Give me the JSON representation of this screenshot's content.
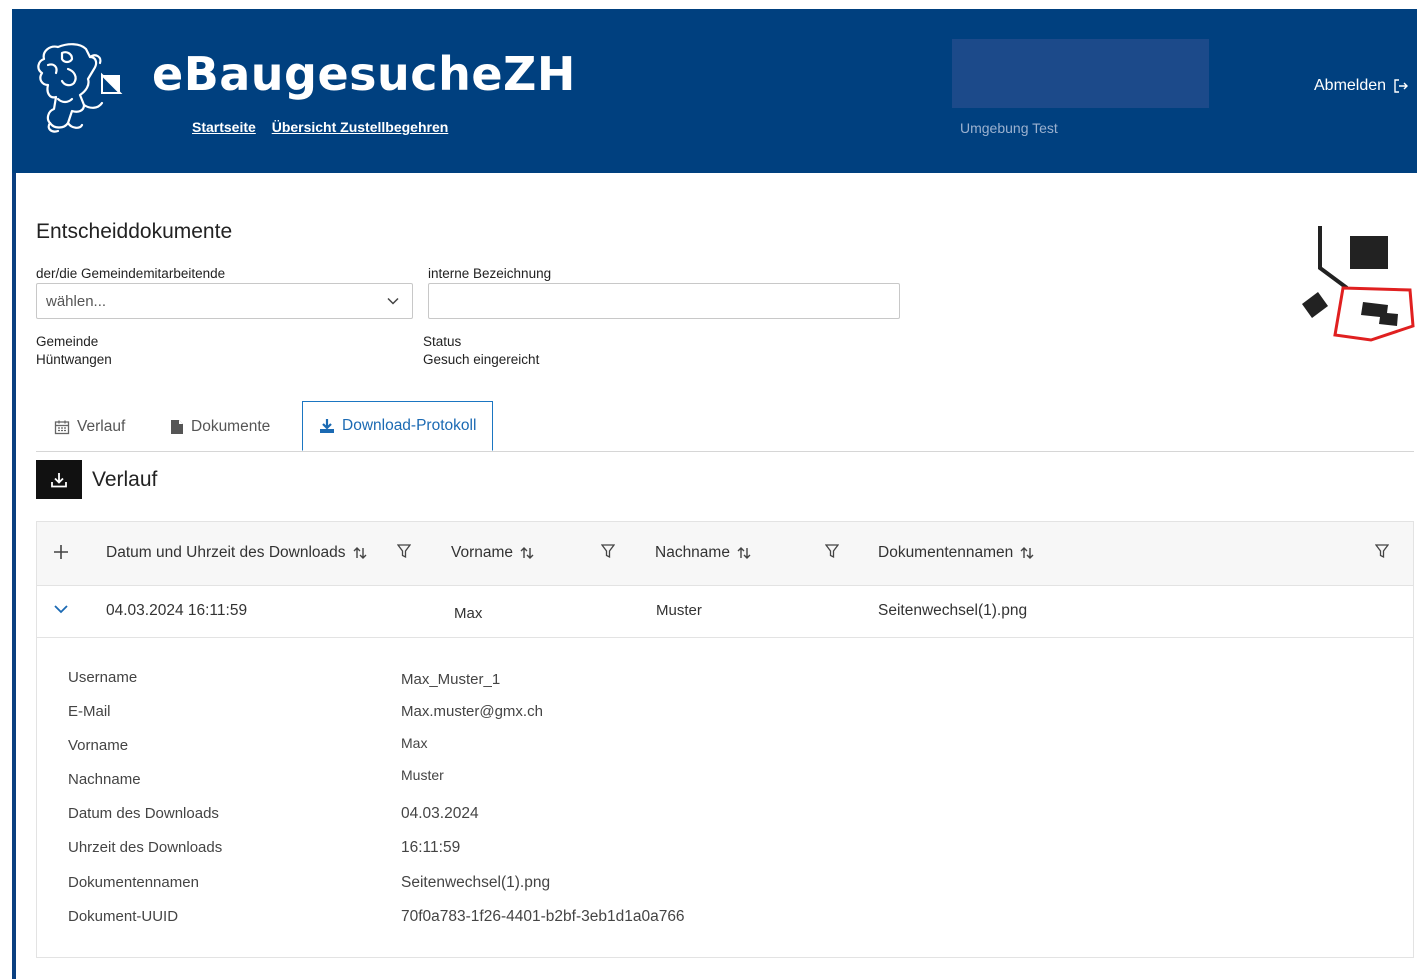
{
  "header": {
    "app_title": "eBaugesucheZH",
    "nav": [
      {
        "label": "Startseite"
      },
      {
        "label": "Übersicht Zustellbegehren"
      }
    ],
    "environment_label": "Umgebung Test",
    "logout_label": "Abmelden"
  },
  "form": {
    "page_title": "Entscheiddokumente",
    "employee_label": "der/die Gemeindemitarbeitende",
    "employee_value": "wählen...",
    "internal_label": "interne Bezeichnung",
    "internal_value": "",
    "municipality_label": "Gemeinde",
    "municipality_value": "Hüntwangen",
    "status_label": "Status",
    "status_value": "Gesuch eingereicht"
  },
  "tabs": [
    {
      "label": "Verlauf",
      "icon": "calendar-icon"
    },
    {
      "label": "Dokumente",
      "icon": "document-icon"
    },
    {
      "label": "Download-Protokoll",
      "icon": "download-icon",
      "active": true
    }
  ],
  "section": {
    "title": "Verlauf"
  },
  "table": {
    "columns": [
      "Datum und Uhrzeit des Downloads",
      "Vorname",
      "Nachname",
      "Dokumentennamen"
    ],
    "rows": [
      {
        "datetime": "04.03.2024 16:11:59",
        "first_name": "Max",
        "last_name": "Muster",
        "document": "Seitenwechsel(1).png"
      }
    ],
    "details": [
      {
        "label": "Username",
        "value": "Max_Muster_1"
      },
      {
        "label": "E-Mail",
        "value": "Max.muster@gmx.ch"
      },
      {
        "label": "Vorname",
        "value": "Max"
      },
      {
        "label": "Nachname",
        "value": "Muster"
      },
      {
        "label": "Datum des Downloads",
        "value": "04.03.2024"
      },
      {
        "label": "Uhrzeit des Downloads",
        "value": "16:11:59"
      },
      {
        "label": "Dokumentennamen",
        "value": "Seitenwechsel(1).png"
      },
      {
        "label": "Dokument-UUID",
        "value": "70f0a783-1f26-4401-b2bf-3eb1d1a0a766"
      }
    ]
  },
  "colors": {
    "header_bg": "#00407f",
    "active_tab": "#1b6ab3",
    "map_highlight": "#e02020"
  }
}
